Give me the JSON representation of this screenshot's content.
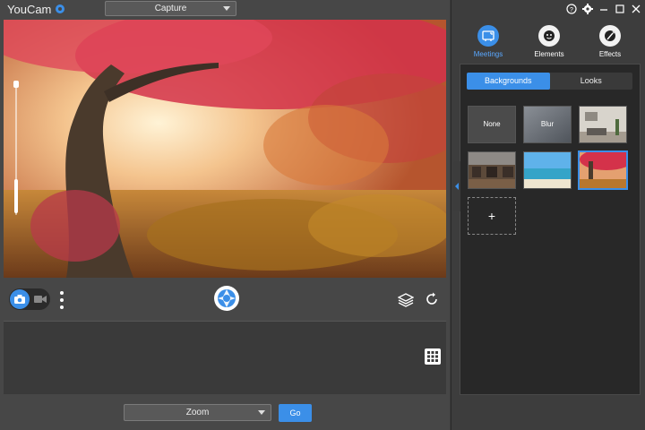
{
  "app": {
    "title": "YouCam"
  },
  "header": {
    "mode_select": "Capture"
  },
  "footer": {
    "zoom_select": "Zoom",
    "go_label": "Go"
  },
  "right_panel": {
    "tabs": [
      {
        "label": "Meetings",
        "icon": "meetings-icon",
        "active": true
      },
      {
        "label": "Elements",
        "icon": "elements-icon",
        "active": false
      },
      {
        "label": "Effects",
        "icon": "effects-icon",
        "active": false
      }
    ],
    "segments": [
      {
        "label": "Backgrounds",
        "active": true
      },
      {
        "label": "Looks",
        "active": false
      }
    ],
    "thumbnails": [
      {
        "label": "None",
        "kind": "none"
      },
      {
        "label": "Blur",
        "kind": "blur"
      },
      {
        "label": "",
        "kind": "living-room"
      },
      {
        "label": "",
        "kind": "cafe"
      },
      {
        "label": "",
        "kind": "beach"
      },
      {
        "label": "",
        "kind": "autumn-forest",
        "selected": true
      },
      {
        "label": "+",
        "kind": "add"
      }
    ]
  },
  "colors": {
    "accent": "#3b8fe8",
    "panel_bg": "#282828",
    "app_bg": "#474747"
  }
}
